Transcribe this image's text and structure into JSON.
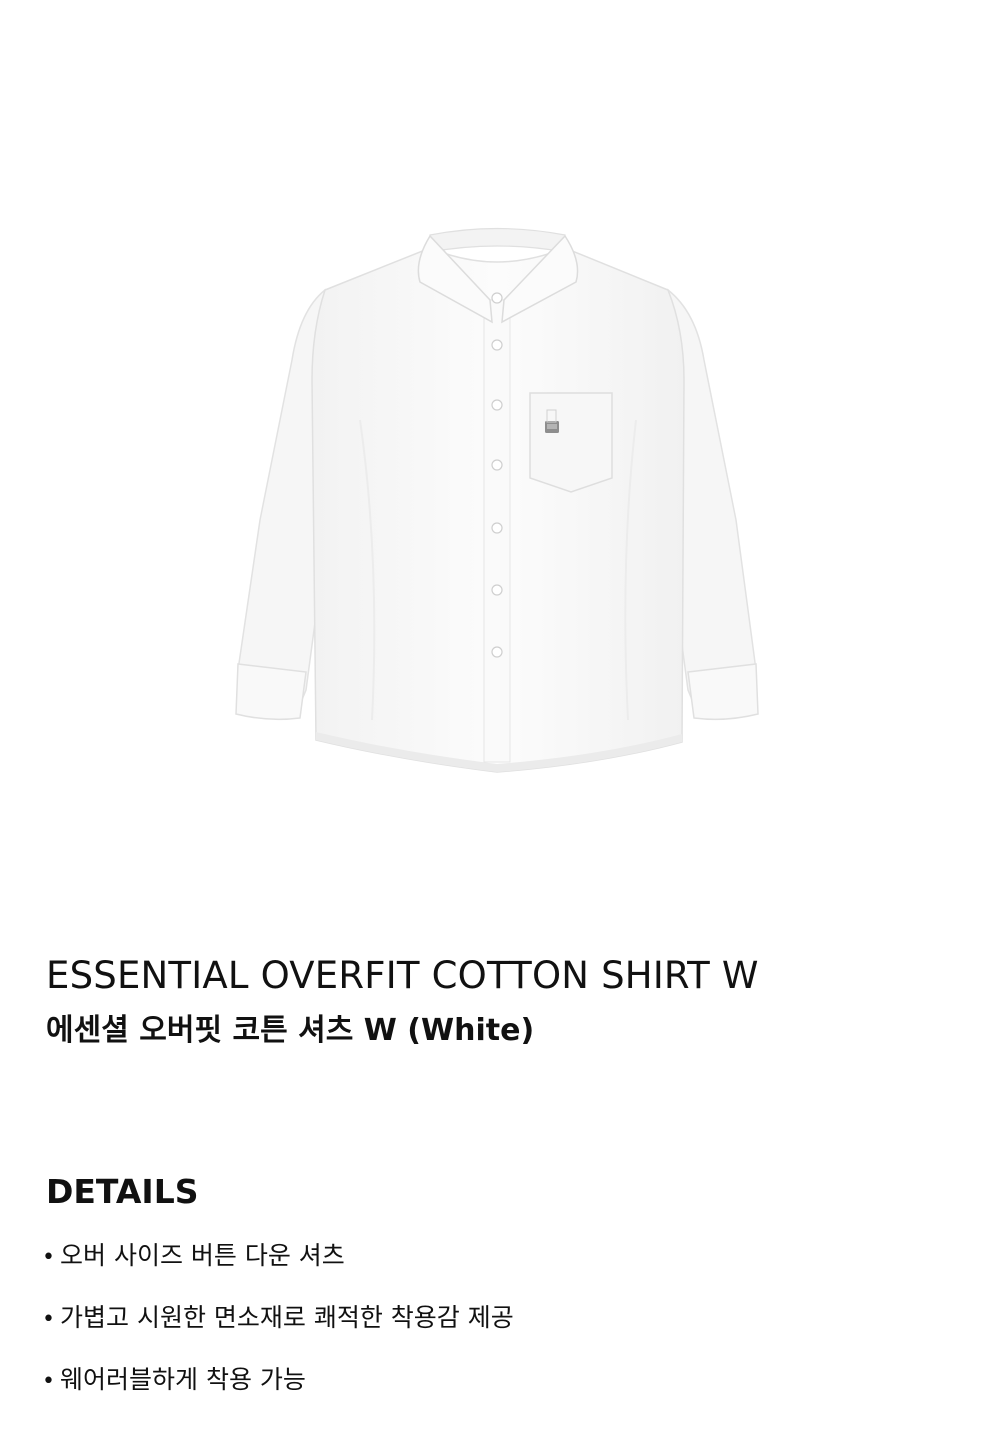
{
  "product": {
    "title": "ESSENTIAL OVERFIT COTTON SHIRT W",
    "subtitle": "에센셜 오버핏 코튼 셔츠 W (White)"
  },
  "details": {
    "heading": "DETAILS",
    "bullet": "•",
    "items": [
      "오버 사이즈 버튼 다운 셔츠",
      "가볍고 시원한 면소재로 쾌적한 착용감 제공",
      "웨어러블하게 착용 가능"
    ]
  },
  "colors": {
    "background": "#ffffff",
    "shirt": "#fbfbfb",
    "shirt_shadow": "#e9e9e9",
    "text": "#111111"
  },
  "image": {
    "subject": "white-shirt-product-photo"
  }
}
